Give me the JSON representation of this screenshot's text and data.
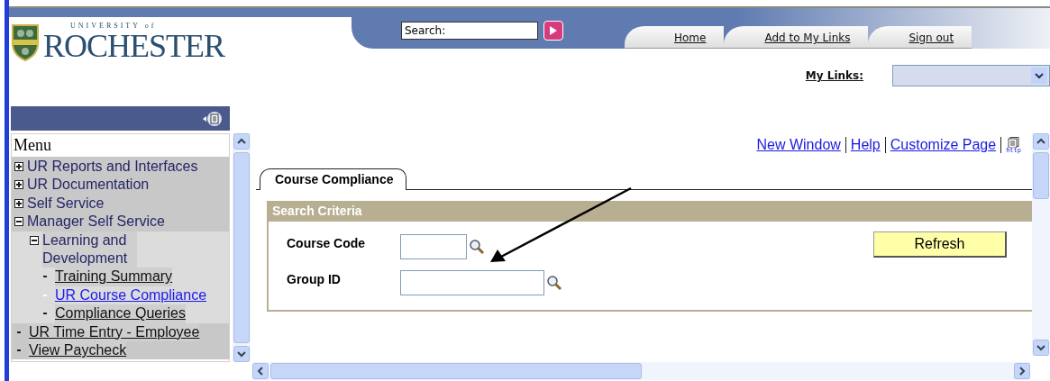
{
  "logo": {
    "tagline": "UNIVERSITY of",
    "name": "ROCHESTER"
  },
  "header": {
    "search": {
      "placeholder": "Search:"
    },
    "nav": [
      {
        "label": "Home"
      },
      {
        "label": "Add to My Links"
      },
      {
        "label": "Sign out"
      }
    ],
    "my_links": {
      "label": "My Links:"
    }
  },
  "menu": {
    "title": "Menu",
    "items": [
      {
        "label": "UR Reports and Interfaces",
        "kind": "folder",
        "expanded": false
      },
      {
        "label": "UR Documentation",
        "kind": "folder",
        "expanded": false
      },
      {
        "label": "Self Service",
        "kind": "folder",
        "expanded": false
      },
      {
        "label": "Manager Self Service",
        "kind": "folder",
        "expanded": true,
        "children": [
          {
            "label": "Learning and Development",
            "kind": "folder",
            "expanded": true,
            "children": [
              {
                "label": "Training Summary",
                "kind": "link",
                "selected": false
              },
              {
                "label": "UR Course Compliance",
                "kind": "link",
                "selected": true
              },
              {
                "label": "Compliance Queries",
                "kind": "link",
                "selected": false
              }
            ]
          }
        ]
      },
      {
        "label": "UR Time Entry - Employee",
        "kind": "link",
        "selected": false
      },
      {
        "label": "View Paycheck",
        "kind": "link",
        "selected": false
      }
    ]
  },
  "toolbar": {
    "links": [
      {
        "label": "New Window"
      },
      {
        "label": "Help"
      },
      {
        "label": "Customize Page"
      }
    ],
    "http_label": "http"
  },
  "tabs": [
    {
      "label": "Course Compliance",
      "selected": true
    }
  ],
  "search_criteria": {
    "title": "Search Criteria",
    "fields": [
      {
        "label": "Course Code"
      },
      {
        "label": "Group ID"
      }
    ],
    "button": "Refresh"
  }
}
